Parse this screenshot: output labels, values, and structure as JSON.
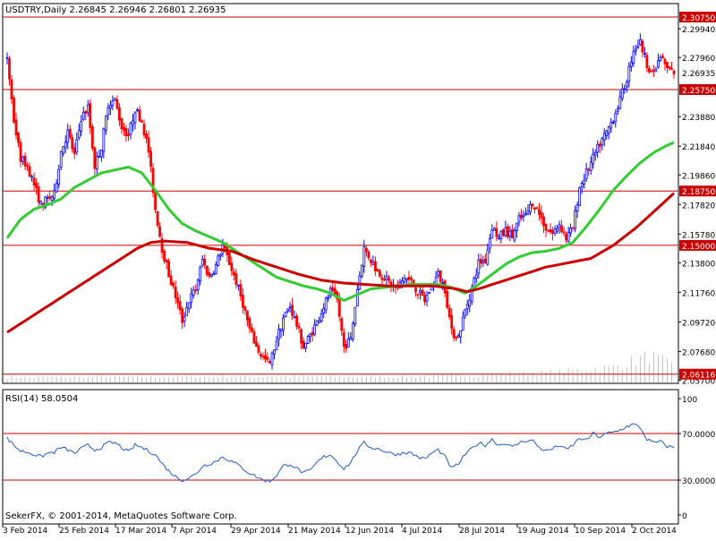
{
  "header": {
    "symbol_line": "USDTRY,Daily  2.26845 2.26946 2.26801 2.26935"
  },
  "footer": {
    "copyright": "SekerFX, © 2001-2014, MetaQuotes Software Corp."
  },
  "colors": {
    "background": "#ffffff",
    "frame": "#000000",
    "candle_bull": "#0000ff",
    "candle_bear": "#ff0000",
    "ma_fast": "#32cd32",
    "ma_slow": "#cc0000",
    "level_line": "#cc0000",
    "level_label_bg": "#cc0000",
    "volume": "#c0c0c0",
    "rsi_line": "#1e5ccf"
  },
  "chart_data": [
    {
      "type": "candlestick",
      "title": "USDTRY,Daily",
      "ohlc_header": {
        "open": 2.26845,
        "high": 2.26946,
        "low": 2.26801,
        "close": 2.26935
      },
      "ylim": [
        2.0548,
        2.3168
      ],
      "price_ticks": [
        "2.29940",
        "2.27960",
        "2.23880",
        "2.21840",
        "2.19860",
        "2.17820",
        "2.15780",
        "2.13800",
        "2.11760",
        "2.09720",
        "2.07680",
        "2.05700"
      ],
      "x_ticks": [
        "3 Feb 2014",
        "25 Feb 2014",
        "17 Mar 2014",
        "7 Apr 2014",
        "29 Apr 2014",
        "21 May 2014",
        "12 Jun 2014",
        "4 Jul 2014",
        "28 Jul 2014",
        "19 Aug 2014",
        "10 Sep 2014",
        "2 Oct 2014"
      ],
      "horizontal_levels": [
        "2.30750",
        "2.25750",
        "2.18750",
        "2.15000",
        "2.06116"
      ],
      "current_price": "2.26935",
      "close_path": [
        [
          0,
          2.28
        ],
        [
          3,
          2.236
        ],
        [
          6,
          2.21
        ],
        [
          9,
          2.205
        ],
        [
          12,
          2.192
        ],
        [
          15,
          2.178
        ],
        [
          18,
          2.182
        ],
        [
          21,
          2.185
        ],
        [
          24,
          2.215
        ],
        [
          27,
          2.228
        ],
        [
          30,
          2.212
        ],
        [
          33,
          2.238
        ],
        [
          36,
          2.245
        ],
        [
          39,
          2.205
        ],
        [
          42,
          2.218
        ],
        [
          45,
          2.248
        ],
        [
          48,
          2.25
        ],
        [
          51,
          2.232
        ],
        [
          54,
          2.226
        ],
        [
          57,
          2.244
        ],
        [
          60,
          2.236
        ],
        [
          63,
          2.215
        ],
        [
          66,
          2.175
        ],
        [
          69,
          2.148
        ],
        [
          72,
          2.13
        ],
        [
          75,
          2.115
        ],
        [
          78,
          2.098
        ],
        [
          81,
          2.112
        ],
        [
          84,
          2.12
        ],
        [
          87,
          2.14
        ],
        [
          90,
          2.128
        ],
        [
          93,
          2.136
        ],
        [
          96,
          2.15
        ],
        [
          99,
          2.138
        ],
        [
          102,
          2.125
        ],
        [
          105,
          2.11
        ],
        [
          108,
          2.092
        ],
        [
          111,
          2.08
        ],
        [
          114,
          2.072
        ],
        [
          117,
          2.068
        ],
        [
          120,
          2.085
        ],
        [
          123,
          2.1
        ],
        [
          126,
          2.108
        ],
        [
          129,
          2.095
        ],
        [
          132,
          2.08
        ],
        [
          135,
          2.088
        ],
        [
          138,
          2.097
        ],
        [
          141,
          2.108
        ],
        [
          144,
          2.118
        ],
        [
          147,
          2.112
        ],
        [
          150,
          2.08
        ],
        [
          153,
          2.085
        ],
        [
          156,
          2.12
        ],
        [
          159,
          2.148
        ],
        [
          162,
          2.14
        ],
        [
          165,
          2.132
        ],
        [
          168,
          2.128
        ],
        [
          171,
          2.123
        ],
        [
          174,
          2.12
        ],
        [
          177,
          2.128
        ],
        [
          180,
          2.125
        ],
        [
          183,
          2.118
        ],
        [
          186,
          2.112
        ],
        [
          189,
          2.122
        ],
        [
          192,
          2.13
        ],
        [
          195,
          2.12
        ],
        [
          198,
          2.09
        ],
        [
          201,
          2.087
        ],
        [
          204,
          2.105
        ],
        [
          207,
          2.12
        ],
        [
          210,
          2.138
        ],
        [
          213,
          2.14
        ],
        [
          216,
          2.163
        ],
        [
          219,
          2.155
        ],
        [
          222,
          2.16
        ],
        [
          225,
          2.156
        ],
        [
          228,
          2.168
        ],
        [
          231,
          2.17
        ],
        [
          234,
          2.18
        ],
        [
          237,
          2.172
        ],
        [
          240,
          2.162
        ],
        [
          243,
          2.158
        ],
        [
          246,
          2.165
        ],
        [
          249,
          2.155
        ],
        [
          252,
          2.162
        ],
        [
          255,
          2.19
        ],
        [
          258,
          2.2
        ],
        [
          261,
          2.21
        ],
        [
          264,
          2.22
        ],
        [
          267,
          2.228
        ],
        [
          270,
          2.238
        ],
        [
          273,
          2.25
        ],
        [
          276,
          2.265
        ],
        [
          279,
          2.285
        ],
        [
          282,
          2.29
        ],
        [
          285,
          2.275
        ],
        [
          288,
          2.268
        ],
        [
          291,
          2.28
        ],
        [
          294,
          2.272
        ],
        [
          297,
          2.2693
        ]
      ],
      "volume_path": [
        [
          0,
          0.18
        ],
        [
          120,
          0.22
        ],
        [
          180,
          0.2
        ],
        [
          210,
          0.28
        ],
        [
          240,
          0.35
        ],
        [
          270,
          0.55
        ],
        [
          286,
          0.95
        ],
        [
          297,
          0.6
        ]
      ],
      "series": [
        {
          "style": "moving-average",
          "values": [
            [
              0,
              2.155
            ],
            [
              6,
              2.168
            ],
            [
              12,
              2.175
            ],
            [
              18,
              2.178
            ],
            [
              24,
              2.182
            ],
            [
              30,
              2.19
            ],
            [
              36,
              2.195
            ],
            [
              42,
              2.2
            ],
            [
              48,
              2.202
            ],
            [
              54,
              2.204
            ],
            [
              60,
              2.2
            ],
            [
              66,
              2.188
            ],
            [
              72,
              2.175
            ],
            [
              78,
              2.165
            ],
            [
              84,
              2.16
            ],
            [
              90,
              2.156
            ],
            [
              96,
              2.152
            ],
            [
              102,
              2.146
            ],
            [
              108,
              2.14
            ],
            [
              114,
              2.134
            ],
            [
              120,
              2.128
            ],
            [
              126,
              2.125
            ],
            [
              132,
              2.122
            ],
            [
              138,
              2.12
            ],
            [
              144,
              2.117
            ],
            [
              150,
              2.112
            ],
            [
              156,
              2.116
            ],
            [
              162,
              2.12
            ],
            [
              168,
              2.121
            ],
            [
              174,
              2.122
            ],
            [
              180,
              2.123
            ],
            [
              186,
              2.123
            ],
            [
              192,
              2.123
            ],
            [
              198,
              2.121
            ],
            [
              204,
              2.117
            ],
            [
              210,
              2.123
            ],
            [
              216,
              2.13
            ],
            [
              222,
              2.137
            ],
            [
              228,
              2.142
            ],
            [
              234,
              2.145
            ],
            [
              240,
              2.146
            ],
            [
              246,
              2.148
            ],
            [
              252,
              2.152
            ],
            [
              258,
              2.163
            ],
            [
              264,
              2.175
            ],
            [
              270,
              2.188
            ],
            [
              276,
              2.198
            ],
            [
              282,
              2.207
            ],
            [
              288,
              2.214
            ],
            [
              294,
              2.219
            ],
            [
              297,
              2.221
            ]
          ]
        },
        {
          "style": "moving-average",
          "values": [
            [
              0,
              2.09
            ],
            [
              10,
              2.1
            ],
            [
              20,
              2.11
            ],
            [
              30,
              2.12
            ],
            [
              40,
              2.13
            ],
            [
              50,
              2.14
            ],
            [
              58,
              2.148
            ],
            [
              64,
              2.152
            ],
            [
              70,
              2.153
            ],
            [
              80,
              2.152
            ],
            [
              90,
              2.148
            ],
            [
              100,
              2.146
            ],
            [
              110,
              2.14
            ],
            [
              120,
              2.135
            ],
            [
              130,
              2.13
            ],
            [
              140,
              2.126
            ],
            [
              150,
              2.124
            ],
            [
              160,
              2.123
            ],
            [
              170,
              2.122
            ],
            [
              180,
              2.122
            ],
            [
              190,
              2.122
            ],
            [
              200,
              2.12
            ],
            [
              205,
              2.118
            ],
            [
              210,
              2.12
            ],
            [
              220,
              2.125
            ],
            [
              230,
              2.13
            ],
            [
              240,
              2.135
            ],
            [
              250,
              2.138
            ],
            [
              260,
              2.141
            ],
            [
              270,
              2.15
            ],
            [
              280,
              2.162
            ],
            [
              290,
              2.176
            ],
            [
              297,
              2.186
            ]
          ]
        }
      ]
    },
    {
      "type": "line",
      "title": "RSI(14) 58.0504",
      "ylim": [
        0,
        100
      ],
      "ticks": [
        "100",
        "70.0000",
        "30.0000",
        "0"
      ],
      "levels": [
        "70.0000",
        "30.0000"
      ],
      "series": [
        {
          "values": [
            [
              0,
              66
            ],
            [
              3,
              60
            ],
            [
              6,
              55
            ],
            [
              9,
              54
            ],
            [
              12,
              52
            ],
            [
              15,
              50
            ],
            [
              18,
              53
            ],
            [
              21,
              54
            ],
            [
              24,
              58
            ],
            [
              27,
              56
            ],
            [
              30,
              53
            ],
            [
              33,
              57
            ],
            [
              36,
              60
            ],
            [
              39,
              56
            ],
            [
              42,
              58
            ],
            [
              45,
              62
            ],
            [
              48,
              62
            ],
            [
              51,
              58
            ],
            [
              54,
              54
            ],
            [
              57,
              60
            ],
            [
              60,
              58
            ],
            [
              63,
              55
            ],
            [
              66,
              52
            ],
            [
              69,
              44
            ],
            [
              72,
              38
            ],
            [
              75,
              33
            ],
            [
              78,
              30
            ],
            [
              81,
              32
            ],
            [
              84,
              35
            ],
            [
              87,
              42
            ],
            [
              90,
              44
            ],
            [
              93,
              46
            ],
            [
              96,
              50
            ],
            [
              99,
              47
            ],
            [
              102,
              44
            ],
            [
              105,
              40
            ],
            [
              108,
              36
            ],
            [
              111,
              33
            ],
            [
              114,
              30
            ],
            [
              117,
              29
            ],
            [
              120,
              34
            ],
            [
              123,
              42
            ],
            [
              126,
              44
            ],
            [
              129,
              40
            ],
            [
              132,
              36
            ],
            [
              135,
              38
            ],
            [
              138,
              45
            ],
            [
              141,
              50
            ],
            [
              144,
              52
            ],
            [
              147,
              46
            ],
            [
              150,
              40
            ],
            [
              153,
              45
            ],
            [
              156,
              55
            ],
            [
              159,
              62
            ],
            [
              162,
              58
            ],
            [
              165,
              57
            ],
            [
              168,
              55
            ],
            [
              171,
              53
            ],
            [
              174,
              52
            ],
            [
              177,
              54
            ],
            [
              180,
              53
            ],
            [
              183,
              50
            ],
            [
              186,
              48
            ],
            [
              189,
              53
            ],
            [
              192,
              56
            ],
            [
              195,
              50
            ],
            [
              198,
              40
            ],
            [
              201,
              44
            ],
            [
              204,
              52
            ],
            [
              207,
              57
            ],
            [
              210,
              62
            ],
            [
              213,
              60
            ],
            [
              216,
              65
            ],
            [
              219,
              60
            ],
            [
              222,
              62
            ],
            [
              225,
              58
            ],
            [
              228,
              62
            ],
            [
              231,
              64
            ],
            [
              234,
              64
            ],
            [
              237,
              58
            ],
            [
              240,
              55
            ],
            [
              243,
              57
            ],
            [
              246,
              60
            ],
            [
              249,
              56
            ],
            [
              252,
              60
            ],
            [
              255,
              66
            ],
            [
              258,
              64
            ],
            [
              261,
              70
            ],
            [
              264,
              67
            ],
            [
              267,
              70
            ],
            [
              270,
              71
            ],
            [
              273,
              73
            ],
            [
              276,
              76
            ],
            [
              279,
              78
            ],
            [
              282,
              75
            ],
            [
              285,
              65
            ],
            [
              288,
              62
            ],
            [
              291,
              63
            ],
            [
              294,
              59
            ],
            [
              297,
              58
            ]
          ]
        }
      ]
    }
  ]
}
